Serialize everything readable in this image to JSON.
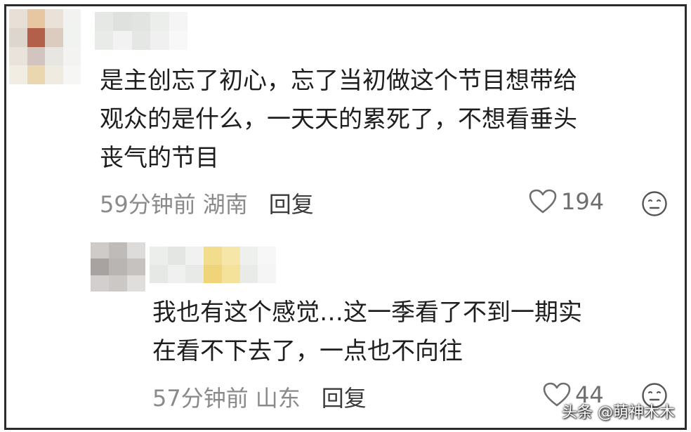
{
  "comments": [
    {
      "text": "是主创忘了初心，忘了当初做这个节目想带给\n观众的是什么，一天天的累死了，不想看垂头\n丧气的节目",
      "time": "59分钟前",
      "location": "湖南",
      "reply_label": "回复",
      "likes": "194",
      "avatar_icon": "pixelated-avatar",
      "like_icon": "heart-outline-icon",
      "emoji_icon": "neutral-face-icon"
    },
    {
      "text": "我也有这个感觉…这一季看了不到一期实\n在看不下去了，一点也不向往",
      "time": "57分钟前",
      "location": "山东",
      "reply_label": "回复",
      "likes": "44",
      "avatar_icon": "pixelated-avatar",
      "like_icon": "heart-outline-icon",
      "emoji_icon": "neutral-face-icon"
    }
  ],
  "watermark": "头条 @萌神木木",
  "colors": {
    "text": "#1e1e1e",
    "meta": "#8a8a8a",
    "reply": "#3a3a3a",
    "icon": "#6e6e6e",
    "border": "#2b2b2b"
  }
}
